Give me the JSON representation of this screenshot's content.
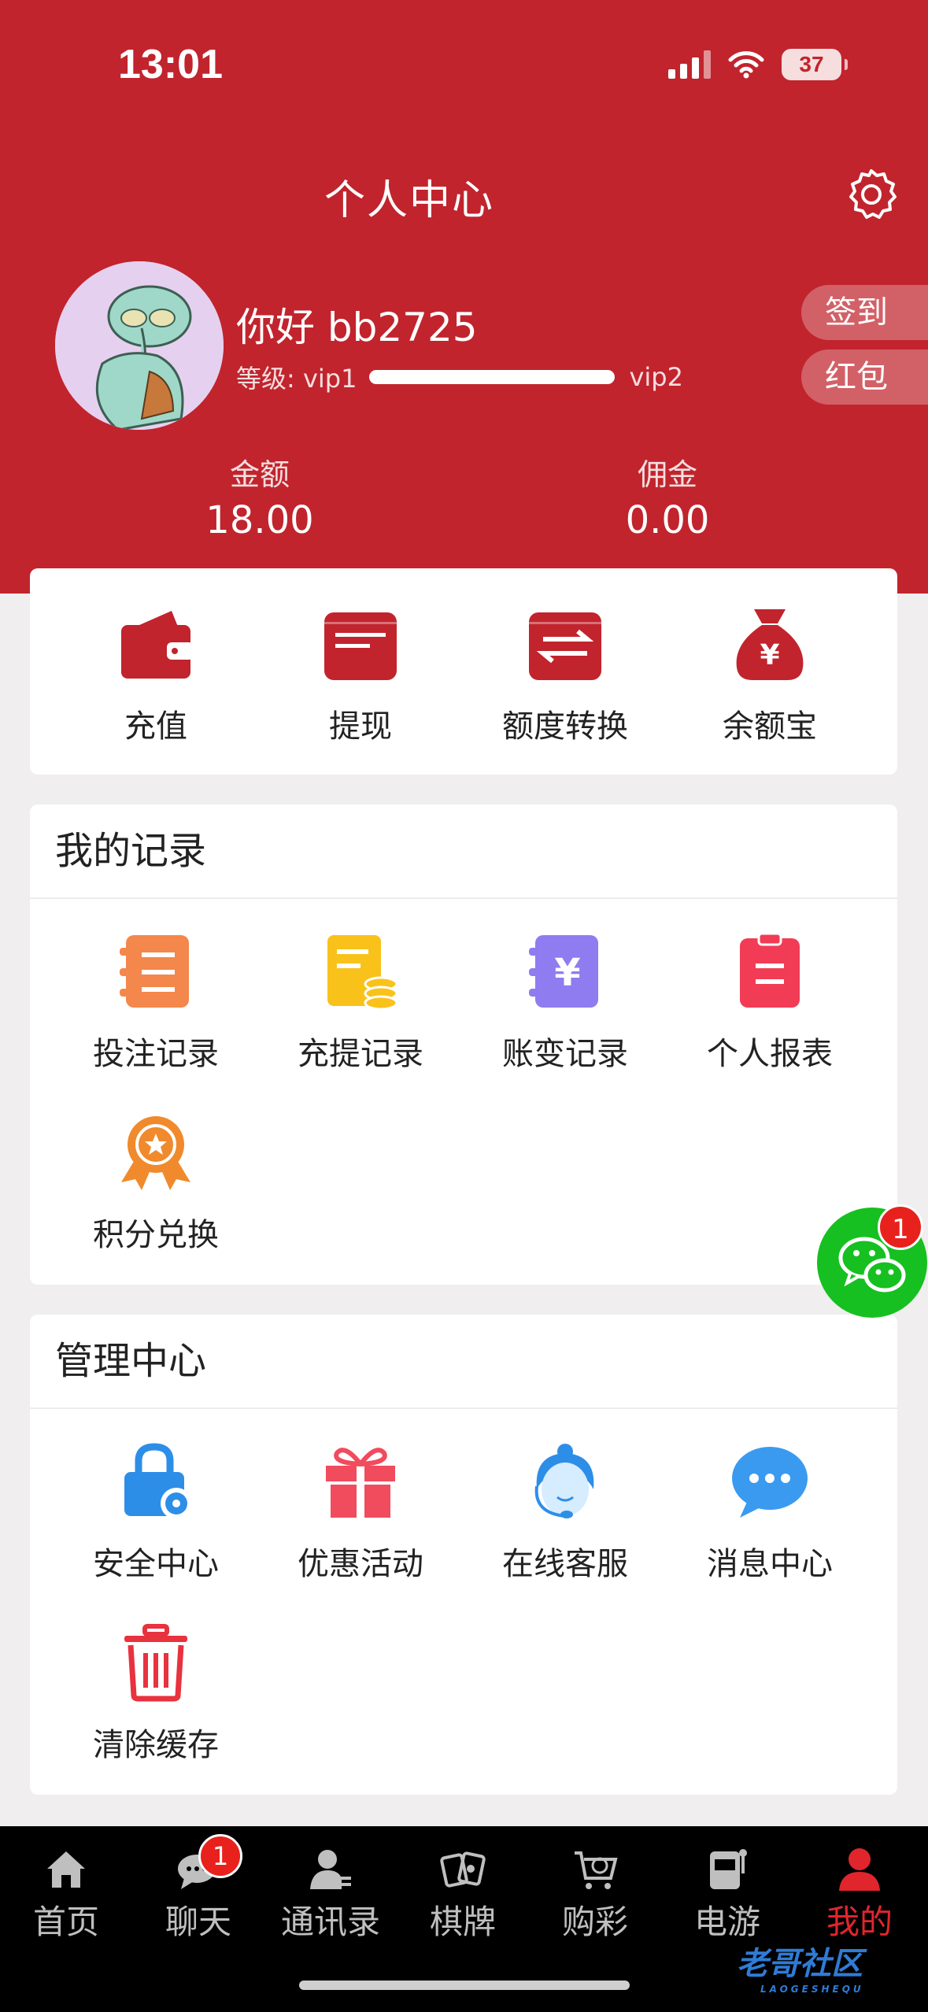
{
  "status": {
    "time": "13:01",
    "battery": "37"
  },
  "header": {
    "title": "个人中心",
    "greeting": "你好 bb2725",
    "level_label": "等级: vip1",
    "next_level": "vip2",
    "checkin_label": "签到",
    "redpacket_label": "红包",
    "balance_label": "金额",
    "balance_value": "18.00",
    "commission_label": "佣金",
    "commission_value": "0.00"
  },
  "quick_actions": [
    {
      "label": "充值",
      "icon": "wallet-icon"
    },
    {
      "label": "提现",
      "icon": "card-icon"
    },
    {
      "label": "额度转换",
      "icon": "transfer-icon"
    },
    {
      "label": "余额宝",
      "icon": "money-bag-icon"
    }
  ],
  "records": {
    "title": "我的记录",
    "items": [
      {
        "label": "投注记录",
        "icon": "bet-record-icon"
      },
      {
        "label": "充提记录",
        "icon": "deposit-record-icon"
      },
      {
        "label": "账变记录",
        "icon": "account-change-icon"
      },
      {
        "label": "个人报表",
        "icon": "report-icon"
      },
      {
        "label": "积分兑换",
        "icon": "medal-icon"
      }
    ]
  },
  "management": {
    "title": "管理中心",
    "items": [
      {
        "label": "安全中心",
        "icon": "lock-gear-icon"
      },
      {
        "label": "优惠活动",
        "icon": "gift-icon"
      },
      {
        "label": "在线客服",
        "icon": "customer-service-icon"
      },
      {
        "label": "消息中心",
        "icon": "chat-bubble-icon"
      },
      {
        "label": "清除缓存",
        "icon": "trash-icon"
      }
    ]
  },
  "floating_chat": {
    "badge": "1",
    "icon": "wechat-icon"
  },
  "tabbar": {
    "items": [
      {
        "label": "首页",
        "icon": "home-icon"
      },
      {
        "label": "聊天",
        "icon": "chat-icon",
        "badge": "1"
      },
      {
        "label": "通讯录",
        "icon": "contacts-icon"
      },
      {
        "label": "棋牌",
        "icon": "cards-icon"
      },
      {
        "label": "购彩",
        "icon": "cart-icon"
      },
      {
        "label": "电游",
        "icon": "slot-machine-icon"
      },
      {
        "label": "我的",
        "icon": "user-icon",
        "active": true
      }
    ]
  },
  "colors": {
    "brand": "#c1242d",
    "tab_active": "#e0252d",
    "chat_green": "#16c020"
  }
}
